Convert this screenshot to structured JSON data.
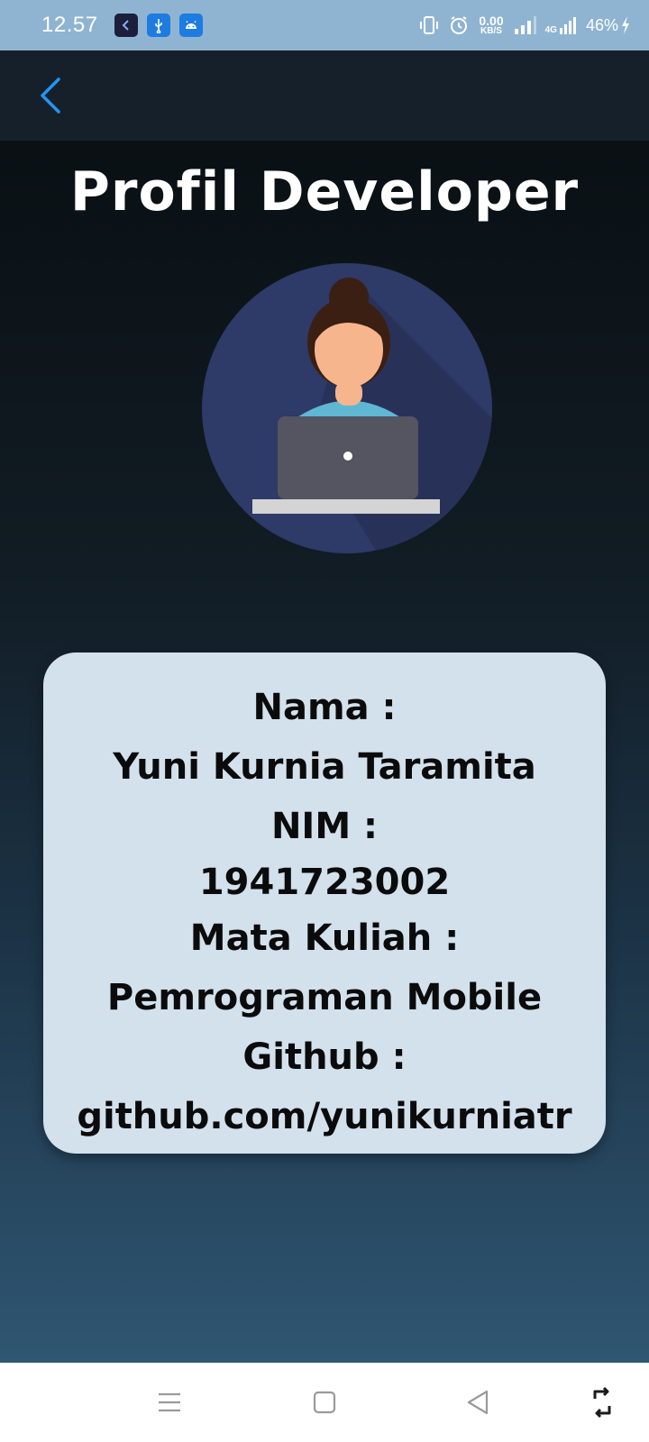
{
  "status_bar": {
    "time": "12.57",
    "notification_icons": [
      "app-icon",
      "usb-icon",
      "android-icon"
    ],
    "net_speed_value": "0.00",
    "net_speed_unit": "KB/S",
    "network_type": "4G",
    "battery": "46%"
  },
  "app_bar": {
    "back_icon": "back-arrow-icon"
  },
  "main": {
    "title": "Profil Developer"
  },
  "info": {
    "name_label": "Nama :",
    "name_value": "Yuni Kurnia Taramita",
    "nim_label": "NIM :",
    "nim_value": "1941723002",
    "course_label": "Mata Kuliah :",
    "course_value": "Pemrograman Mobile",
    "github_label": "Github :",
    "github_value": "github.com/yunikurniatr"
  },
  "nav_bar": {
    "icons": [
      "menu-icon",
      "home-icon",
      "back-icon",
      "rotate-icon"
    ]
  },
  "colors": {
    "accent": "#2196f3",
    "status_bar": "#8fb4d2",
    "app_bar": "#16202b",
    "card": "#d3e1ed",
    "avatar_bg": "#2e3a67"
  }
}
